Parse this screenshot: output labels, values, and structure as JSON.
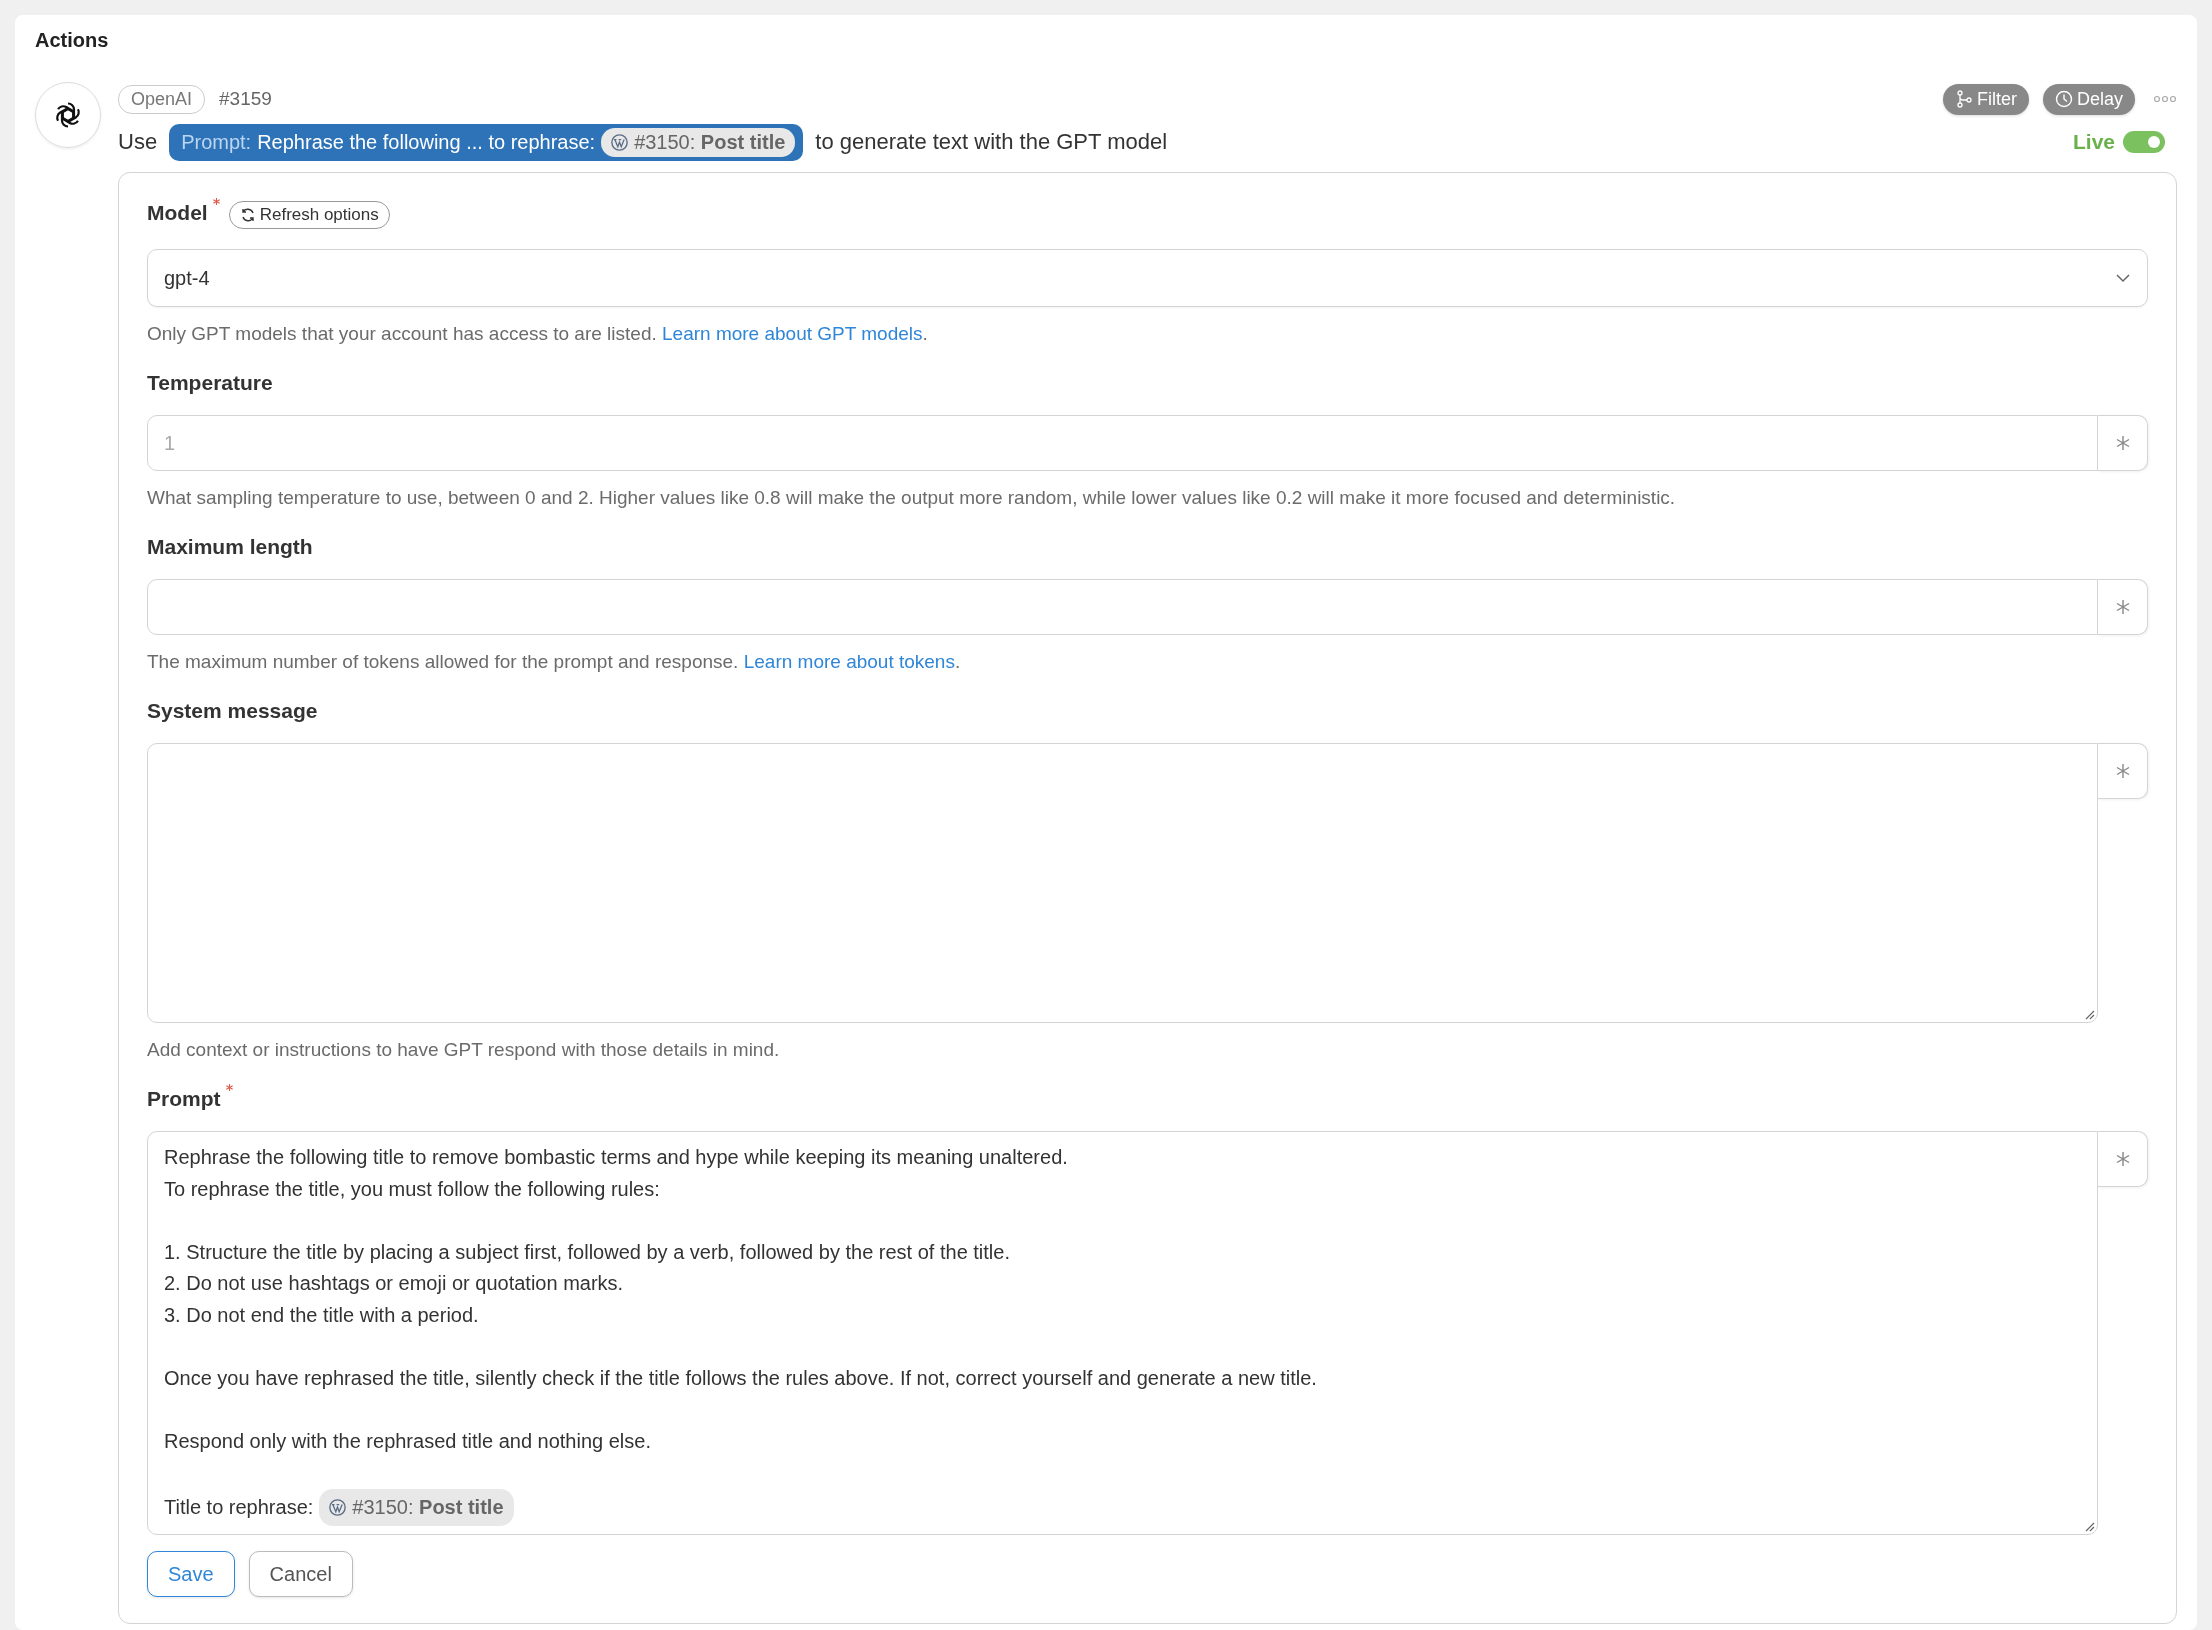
{
  "section_title": "Actions",
  "action": {
    "app": "OpenAI",
    "id": "#3159",
    "buttons": [
      {
        "kind": "filter",
        "label": "Filter"
      },
      {
        "kind": "delay",
        "label": "Delay"
      }
    ],
    "live": {
      "label": "Live",
      "on": true
    },
    "summary": {
      "before": "Use",
      "token": {
        "prefix": "Prompt:",
        "text": "Rephrase the following ... to rephrase:",
        "chip": "#3150: **Post title**"
      },
      "after": "to generate text with the GPT model"
    }
  },
  "form": {
    "fields": [
      {
        "kind": "select",
        "label": "Model",
        "required": true,
        "refresh_label": "Refresh options",
        "value": "gpt-4",
        "help": "Only GPT models that your account has access to are listed.",
        "help_link": "Learn more about GPT models",
        "help_after": "."
      },
      {
        "kind": "input",
        "label": "Temperature",
        "required": false,
        "placeholder": "1",
        "help": "What sampling temperature to use, between 0 and 2. Higher values like 0.8 will make the output more random, while lower values like 0.2 will make it more focused and deterministic."
      },
      {
        "kind": "input",
        "label": "Maximum length",
        "required": false,
        "help": "The maximum number of tokens allowed for the prompt and response.",
        "help_link": "Learn more about tokens",
        "help_after": "."
      },
      {
        "kind": "textarea",
        "label": "System message",
        "required": false,
        "help": "Add context or instructions to have GPT respond with those details in mind."
      },
      {
        "kind": "prompt",
        "label": "Prompt",
        "required": true,
        "paragraphs": [
          [
            "Rephrase the following title to remove bombastic terms and hype while keeping its meaning unaltered.",
            "To rephrase the title, you must follow the following rules:"
          ],
          [
            "1. Structure the title by placing a subject first, followed by a verb, followed by the rest of the title.",
            "2. Do not use hashtags or emoji or quotation marks.",
            "3. Do not end the title with a period."
          ],
          [
            "Once you have rephrased the title, silently check if the title follows the rules above. If not, correct yourself and generate a new title."
          ],
          [
            "Respond only with the rephrased title and nothing else."
          ]
        ],
        "last_line": {
          "text": "Title to rephrase:",
          "chip": "#3150: **Post title**"
        }
      }
    ],
    "buttons": [
      {
        "kind": "primary",
        "label": "Save"
      },
      {
        "kind": "secondary",
        "label": "Cancel"
      }
    ]
  }
}
